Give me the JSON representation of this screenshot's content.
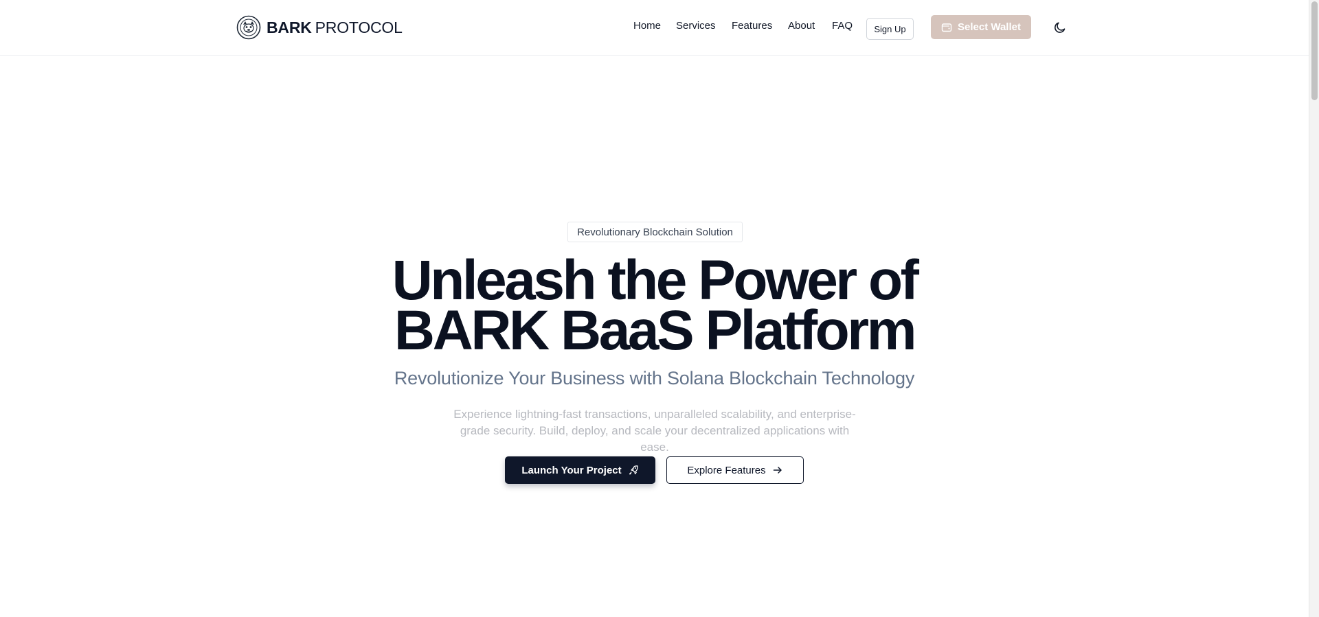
{
  "brand": {
    "name_bold": "BARK",
    "name_light": "PROTOCOL",
    "logo_icon": "bark-logo-icon"
  },
  "nav": {
    "items": [
      {
        "label": "Home"
      },
      {
        "label": "Services"
      },
      {
        "label": "Features"
      },
      {
        "label": "About"
      },
      {
        "label": "FAQ"
      }
    ],
    "signup_label": "Sign Up",
    "wallet_label": "Select Wallet",
    "wallet_icon": "wallet-icon",
    "theme_icon": "moon-icon"
  },
  "hero": {
    "badge": "Revolutionary Blockchain Solution",
    "title_line1": "Unleash the Power of",
    "title_line2": "BARK BaaS Platform",
    "subtitle": "Revolutionize Your Business with Solana Blockchain Technology",
    "description_line1": "Experience lightning-fast transactions, unparalleled scalability, and enterprise-",
    "description_line2": "grade security. Build, deploy, and scale your decentralized applications with ease.",
    "cta_primary": "Launch Your Project",
    "cta_primary_icon": "rocket-icon",
    "cta_secondary": "Explore Features",
    "cta_secondary_icon": "arrow-right-icon"
  },
  "colors": {
    "primary": "#0f172a",
    "wallet_button": "#d6c4bc",
    "subtitle": "#64748b",
    "description": "#b7b9bf"
  }
}
